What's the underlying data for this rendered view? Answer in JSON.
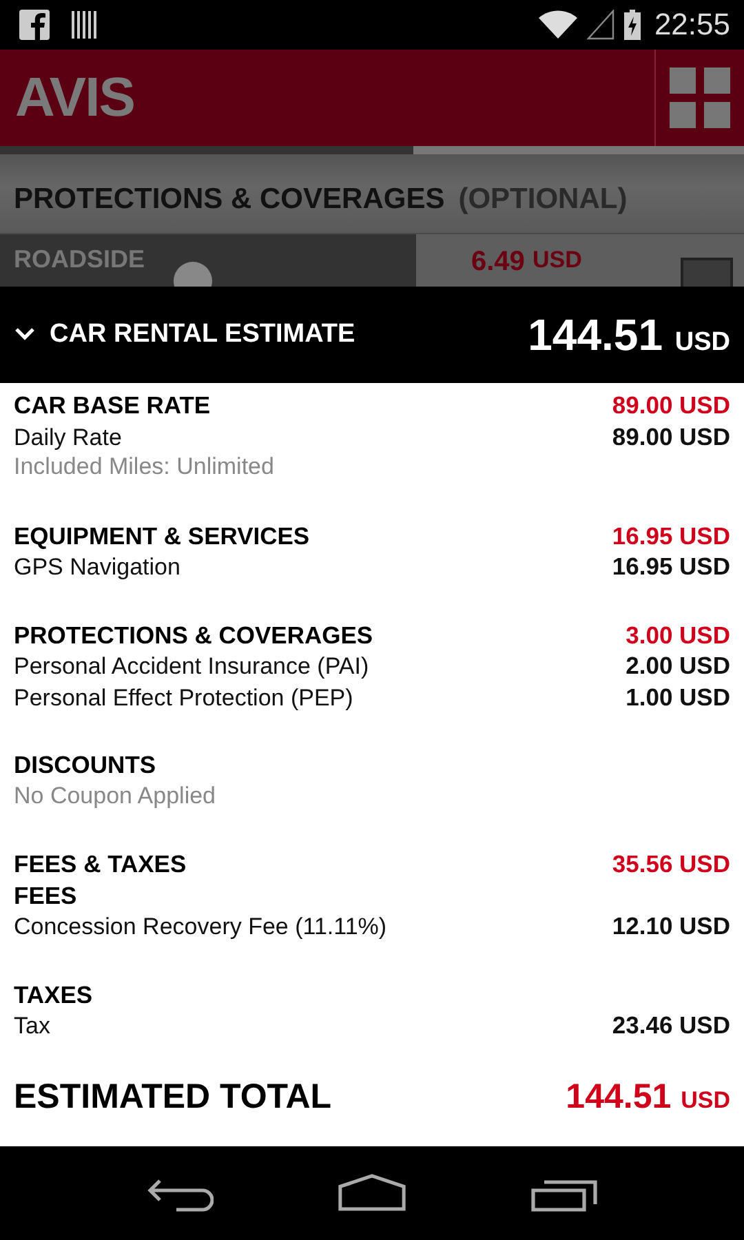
{
  "status_bar": {
    "time": "22:55"
  },
  "header": {
    "logo": "AVIS"
  },
  "background": {
    "title": "PROTECTIONS & COVERAGES",
    "subtitle": "(OPTIONAL)",
    "item": {
      "label": "ROADSIDE",
      "price": "6.49",
      "currency": "USD",
      "checked": false
    }
  },
  "estimate_bar": {
    "title": "CAR RENTAL ESTIMATE",
    "expanded": true,
    "total": "144.51",
    "currency": "USD"
  },
  "groups": [
    {
      "title": "CAR BASE RATE",
      "amount": "89.00 USD",
      "lines": [
        {
          "kind": "item",
          "label": "Daily Rate",
          "value": "89.00 USD"
        },
        {
          "kind": "note",
          "label": "Included Miles: Unlimited"
        }
      ]
    },
    {
      "title": "EQUIPMENT & SERVICES",
      "amount": "16.95 USD",
      "lines": [
        {
          "kind": "item",
          "label": "GPS Navigation",
          "value": "16.95 USD"
        }
      ]
    },
    {
      "title": "PROTECTIONS & COVERAGES",
      "amount": "3.00 USD",
      "lines": [
        {
          "kind": "item",
          "label": "Personal Accident Insurance (PAI)",
          "value": "2.00 USD"
        },
        {
          "kind": "item",
          "label": "Personal Effect Protection (PEP)",
          "value": "1.00 USD"
        }
      ]
    },
    {
      "title": "DISCOUNTS",
      "lines": [
        {
          "kind": "note",
          "label": "No Coupon Applied"
        }
      ]
    },
    {
      "title": "FEES & TAXES",
      "amount": "35.56 USD",
      "lines": [
        {
          "kind": "subheading",
          "label": "FEES"
        },
        {
          "kind": "item",
          "label": "Concession Recovery Fee (11.11%)",
          "value": "12.10 USD"
        }
      ]
    },
    {
      "title": "TAXES",
      "lines": [
        {
          "kind": "item",
          "label": "Tax",
          "value": "23.46 USD"
        }
      ]
    }
  ],
  "estimated_total": {
    "label": "ESTIMATED TOTAL",
    "amount": "144.51",
    "currency": "USD"
  }
}
